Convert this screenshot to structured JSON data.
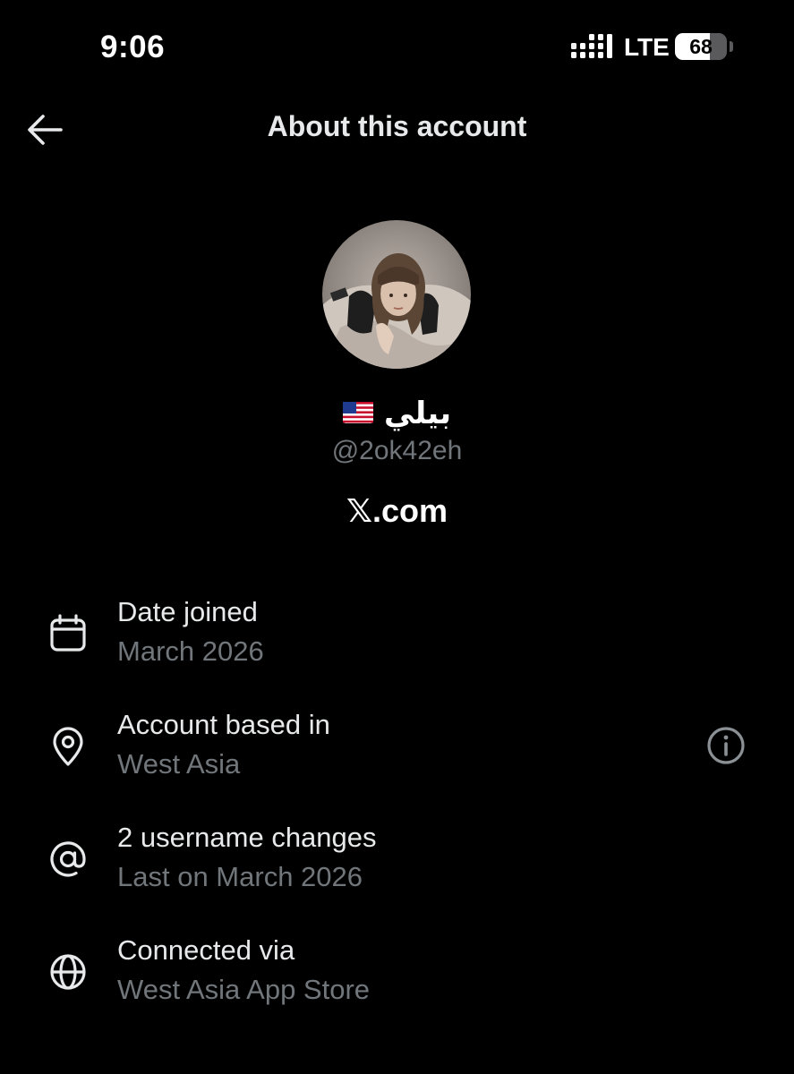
{
  "status_bar": {
    "time": "9:06",
    "network": "LTE",
    "battery": "68",
    "battery_level": 0.68
  },
  "header": {
    "title": "About this account",
    "back_icon": "arrow-left-icon"
  },
  "profile": {
    "display_name": "بيلي",
    "flag_icon": "us-flag-icon",
    "handle": "@2ok42eh",
    "platform": "𝕏.com"
  },
  "details": [
    {
      "icon": "calendar-icon",
      "title": "Date joined",
      "value": "March 2026"
    },
    {
      "icon": "location-pin-icon",
      "title": "Account based in",
      "value": "West Asia",
      "info_icon": "info-icon"
    },
    {
      "icon": "at-sign-icon",
      "title": "2 username changes",
      "value": "Last on March 2026"
    },
    {
      "icon": "globe-icon",
      "title": "Connected via",
      "value": "West Asia App Store"
    }
  ],
  "colors": {
    "background": "#000000",
    "primary_text": "#e7e9ea",
    "secondary_text": "#71767b"
  }
}
